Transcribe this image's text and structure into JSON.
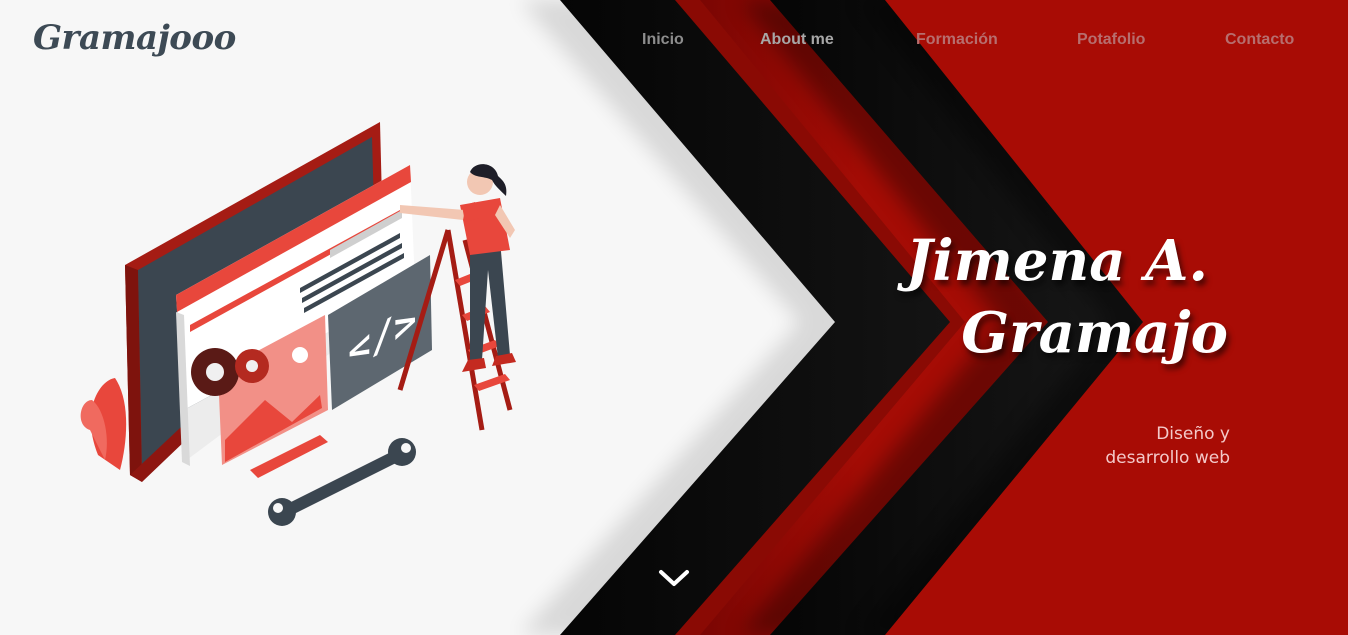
{
  "brand": {
    "logo_text": "Gramajooo"
  },
  "nav": {
    "items": [
      {
        "label": "Inicio"
      },
      {
        "label": "About me"
      },
      {
        "label": "Formación"
      },
      {
        "label": "Potafolio"
      },
      {
        "label": "Contacto"
      }
    ]
  },
  "hero": {
    "name_line1": "Jimena A.",
    "name_line2": "Gramajo",
    "subtitle_line1": "Diseño y",
    "subtitle_line2": "desarrollo web"
  },
  "icons": {
    "scroll": "chevron-down-icon",
    "illustration": "web-developer-illustration"
  },
  "colors": {
    "red": "#a80c05",
    "dark": "#161616",
    "light": "#f7f7f7",
    "logo": "#3d4a55",
    "illus_red": "#e8473c",
    "illus_dark": "#3b4650"
  }
}
